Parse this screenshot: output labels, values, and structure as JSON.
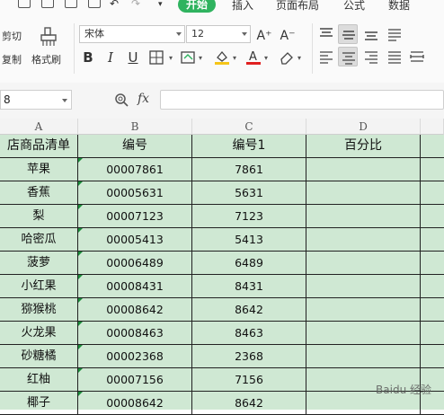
{
  "tabs": [
    {
      "label": "开始",
      "active": true
    },
    {
      "label": "插入",
      "active": false
    },
    {
      "label": "页面布局",
      "active": false
    },
    {
      "label": "公式",
      "active": false
    },
    {
      "label": "数据",
      "active": false
    }
  ],
  "clipboard": {
    "cut_label": "剪切",
    "copy_label": "复制",
    "painter_label": "格式刷"
  },
  "font": {
    "family": "宋体",
    "size": "12",
    "grow": "A⁺",
    "shrink": "A⁻"
  },
  "format_buttons": {
    "bold": "B",
    "italic": "I",
    "underline": "U"
  },
  "accent_colors": {
    "tab_active": "#2fb35f",
    "font_color": "#e02020",
    "fill_color": "#f5c518",
    "grid_bg": "#cfe8d3"
  },
  "formula_bar": {
    "name_box": "8",
    "fx": "fx",
    "content": ""
  },
  "columns": [
    "A",
    "B",
    "C",
    "D"
  ],
  "table": {
    "headers": [
      "店商品清单",
      "编号",
      "编号1",
      "百分比"
    ],
    "rows": [
      [
        "苹果",
        "00007861",
        "7861",
        ""
      ],
      [
        "香蕉",
        "00005631",
        "5631",
        ""
      ],
      [
        "梨",
        "00007123",
        "7123",
        ""
      ],
      [
        "哈密瓜",
        "00005413",
        "5413",
        ""
      ],
      [
        "菠萝",
        "00006489",
        "6489",
        ""
      ],
      [
        "小红果",
        "00008431",
        "8431",
        ""
      ],
      [
        "猕猴桃",
        "00008642",
        "8642",
        ""
      ],
      [
        "火龙果",
        "00008463",
        "8463",
        ""
      ],
      [
        "砂糖橘",
        "00002368",
        "2368",
        ""
      ],
      [
        "红柚",
        "00007156",
        "7156",
        ""
      ],
      [
        "椰子",
        "00008642",
        "8642",
        ""
      ]
    ]
  },
  "watermark": "Baidu 经验"
}
